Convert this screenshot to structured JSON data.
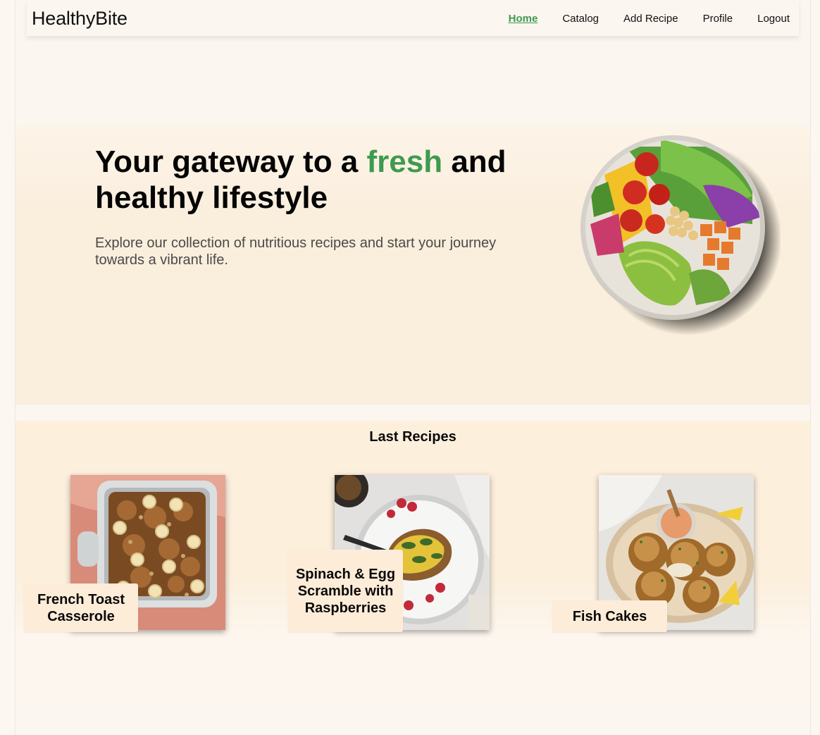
{
  "nav": {
    "logo": "HealthyBite",
    "links": [
      "Home",
      "Catalog",
      "Add Recipe",
      "Profile",
      "Logout"
    ],
    "active": "Home"
  },
  "hero": {
    "title_before": "Your gateway to a ",
    "title_accent": "fresh",
    "title_after": " and healthy lifestyle",
    "subtitle": "Explore our collection of nutritious recipes and start your journey towards a vibrant life."
  },
  "recipes": {
    "heading": "Last Recipes",
    "items": [
      {
        "name": "French Toast Casserole"
      },
      {
        "name": "Spinach & Egg Scramble with Raspberries"
      },
      {
        "name": "Fish Cakes"
      }
    ]
  },
  "colors": {
    "accent": "#3e9a4f",
    "label_bg": "#fdecd8",
    "hero_bg": "#faeedc"
  }
}
